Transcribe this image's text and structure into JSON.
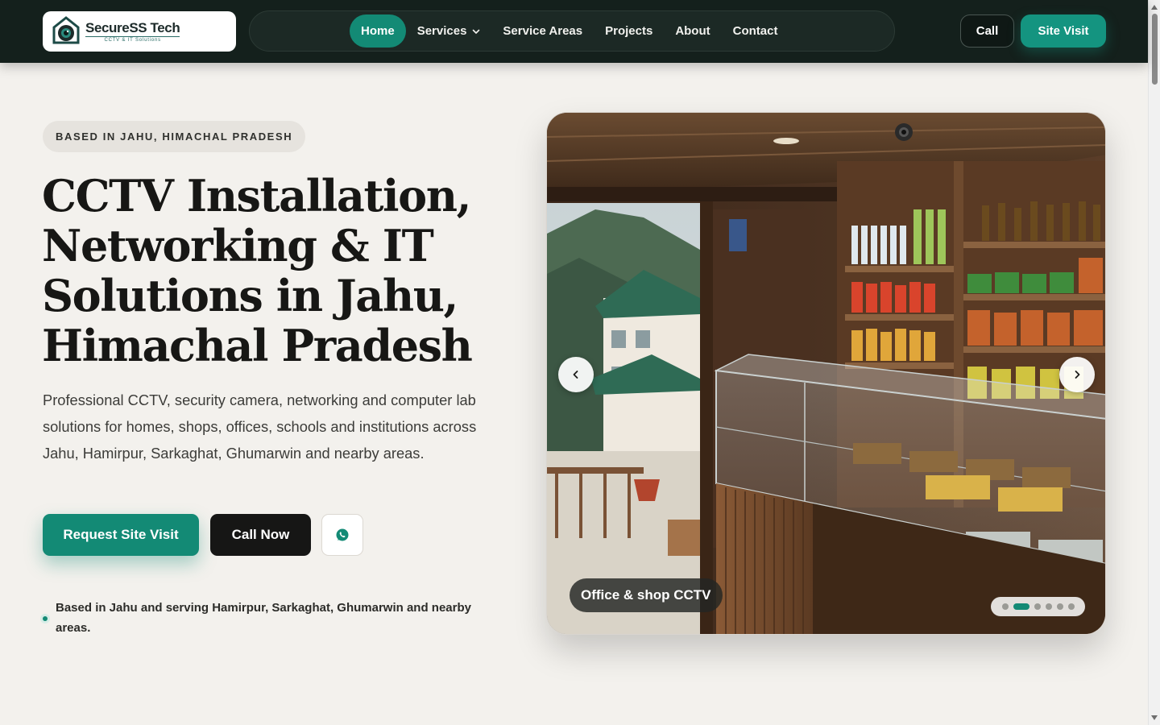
{
  "header": {
    "logo": {
      "name_part1": "Secure",
      "name_part2": "SS Tech",
      "tagline": "CCTV & IT Solutions"
    },
    "nav": [
      {
        "label": "Home",
        "active": true
      },
      {
        "label": "Services",
        "has_dropdown": true
      },
      {
        "label": "Service Areas"
      },
      {
        "label": "Projects"
      },
      {
        "label": "About"
      },
      {
        "label": "Contact"
      }
    ],
    "call_label": "Call",
    "site_visit_label": "Site Visit"
  },
  "hero": {
    "badge": "BASED IN JAHU, HIMACHAL PRADESH",
    "title_lines": [
      "CCTV Installation,",
      "Networking & IT",
      "Solutions in Jahu,",
      "Himachal Pradesh"
    ],
    "description": "Professional CCTV, security camera, networking and computer lab solutions for homes, shops, offices, schools and institutions across Jahu, Hamirpur, Sarkaghat, Ghumarwin and nearby areas.",
    "request_button": "Request Site Visit",
    "call_button": "Call Now",
    "whatsapp_icon": "whatsapp-icon",
    "note": "Based in Jahu and serving Hamirpur, Sarkaghat, Ghumarwin and nearby areas."
  },
  "carousel": {
    "caption": "Office & shop CCTV",
    "slide_count": 6,
    "active_index": 1
  },
  "colors": {
    "accent": "#138a75",
    "header_bg": "#14201c",
    "page_bg": "#f3f1ed"
  }
}
